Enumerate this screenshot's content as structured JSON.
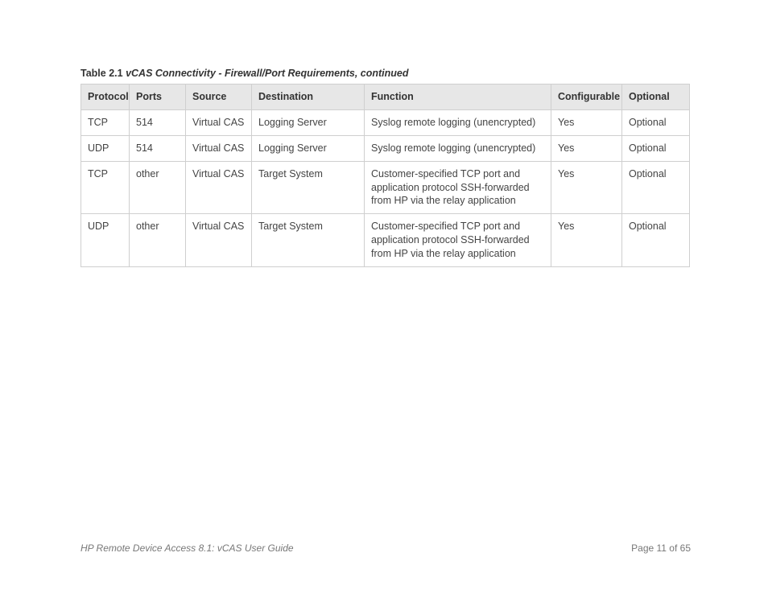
{
  "caption": {
    "label": "Table 2.1",
    "title": "vCAS Connectivity - Firewall/Port Requirements, continued"
  },
  "table": {
    "headers": {
      "protocol": "Protocol",
      "ports": "Ports",
      "source": "Source",
      "destination": "Destination",
      "function": "Function",
      "configurable": "Configurable",
      "optional": "Optional"
    },
    "rows": [
      {
        "protocol": "TCP",
        "ports": "514",
        "source": "Virtual CAS",
        "destination": "Logging Server",
        "function": "Syslog remote logging (unencrypted)",
        "configurable": "Yes",
        "optional": "Optional"
      },
      {
        "protocol": "UDP",
        "ports": "514",
        "source": "Virtual CAS",
        "destination": "Logging Server",
        "function": "Syslog remote logging (unencrypted)",
        "configurable": "Yes",
        "optional": "Optional"
      },
      {
        "protocol": "TCP",
        "ports": "other",
        "source": "Virtual CAS",
        "destination": "Target System",
        "function": "Customer-specified TCP port and application protocol SSH-forwarded from HP via the relay application",
        "configurable": "Yes",
        "optional": "Optional"
      },
      {
        "protocol": "UDP",
        "ports": "other",
        "source": "Virtual CAS",
        "destination": "Target System",
        "function": "Customer-specified TCP port and application protocol SSH-forwarded from HP via the relay application",
        "configurable": "Yes",
        "optional": "Optional"
      }
    ]
  },
  "footer": {
    "left": "HP Remote Device Access 8.1: vCAS User Guide",
    "right": "Page 11 of 65"
  }
}
